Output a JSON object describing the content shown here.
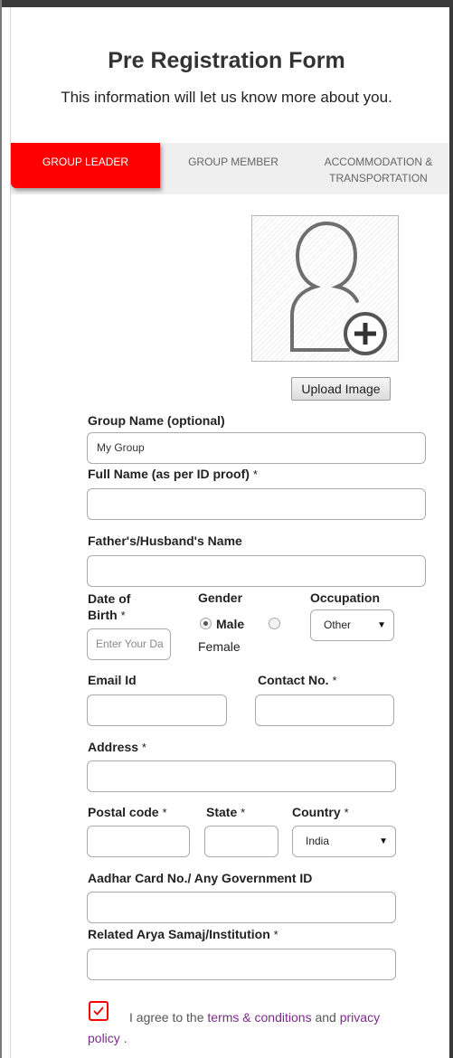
{
  "header": {
    "title": "Pre Registration Form",
    "subtitle": "This information will let us know more about you."
  },
  "tabs": [
    {
      "label": "GROUP LEADER"
    },
    {
      "label": "GROUP MEMBER"
    },
    {
      "label_line1": "ACCOMMODATION &",
      "label_line2": "TRANSPORTATION"
    }
  ],
  "colors": {
    "accent": "#ff0000",
    "link": "#7b2a8b"
  },
  "photo": {
    "icon": "user-add-icon",
    "upload_label": "Upload Image"
  },
  "form": {
    "group_name": {
      "label": "Group Name (optional)",
      "value": "My Group"
    },
    "full_name": {
      "label": "Full Name (as per ID proof)",
      "req": "*",
      "value": ""
    },
    "father_name": {
      "label": "Father's/Husband's Name",
      "value": ""
    },
    "dob": {
      "label_line1": "Date of",
      "label_line2": "Birth",
      "req": "*",
      "placeholder": "Enter Your Da"
    },
    "gender": {
      "label": "Gender",
      "options": [
        {
          "label": "Male",
          "selected": true
        },
        {
          "label": "Female",
          "selected": false
        }
      ]
    },
    "occupation": {
      "label": "Occupation",
      "value": "Other"
    },
    "email": {
      "label": "Email Id",
      "value": ""
    },
    "contact": {
      "label": "Contact No.",
      "req": "*",
      "value": ""
    },
    "address": {
      "label": "Address",
      "req": "*",
      "value": ""
    },
    "postal": {
      "label": "Postal code",
      "req": "*",
      "value": ""
    },
    "state": {
      "label": "State",
      "req": "*",
      "value": ""
    },
    "country": {
      "label": "Country",
      "req": "*",
      "value": "India"
    },
    "aadhar": {
      "label": "Aadhar Card No./ Any Government ID",
      "value": ""
    },
    "samaj": {
      "label": "Related Arya Samaj/Institution",
      "req": "*",
      "value": ""
    }
  },
  "agreement": {
    "checked": true,
    "text_before": "I agree to the",
    "terms_link": "terms & conditions",
    "text_middle": "and",
    "privacy_link": "privacy policy",
    "text_after": "."
  }
}
